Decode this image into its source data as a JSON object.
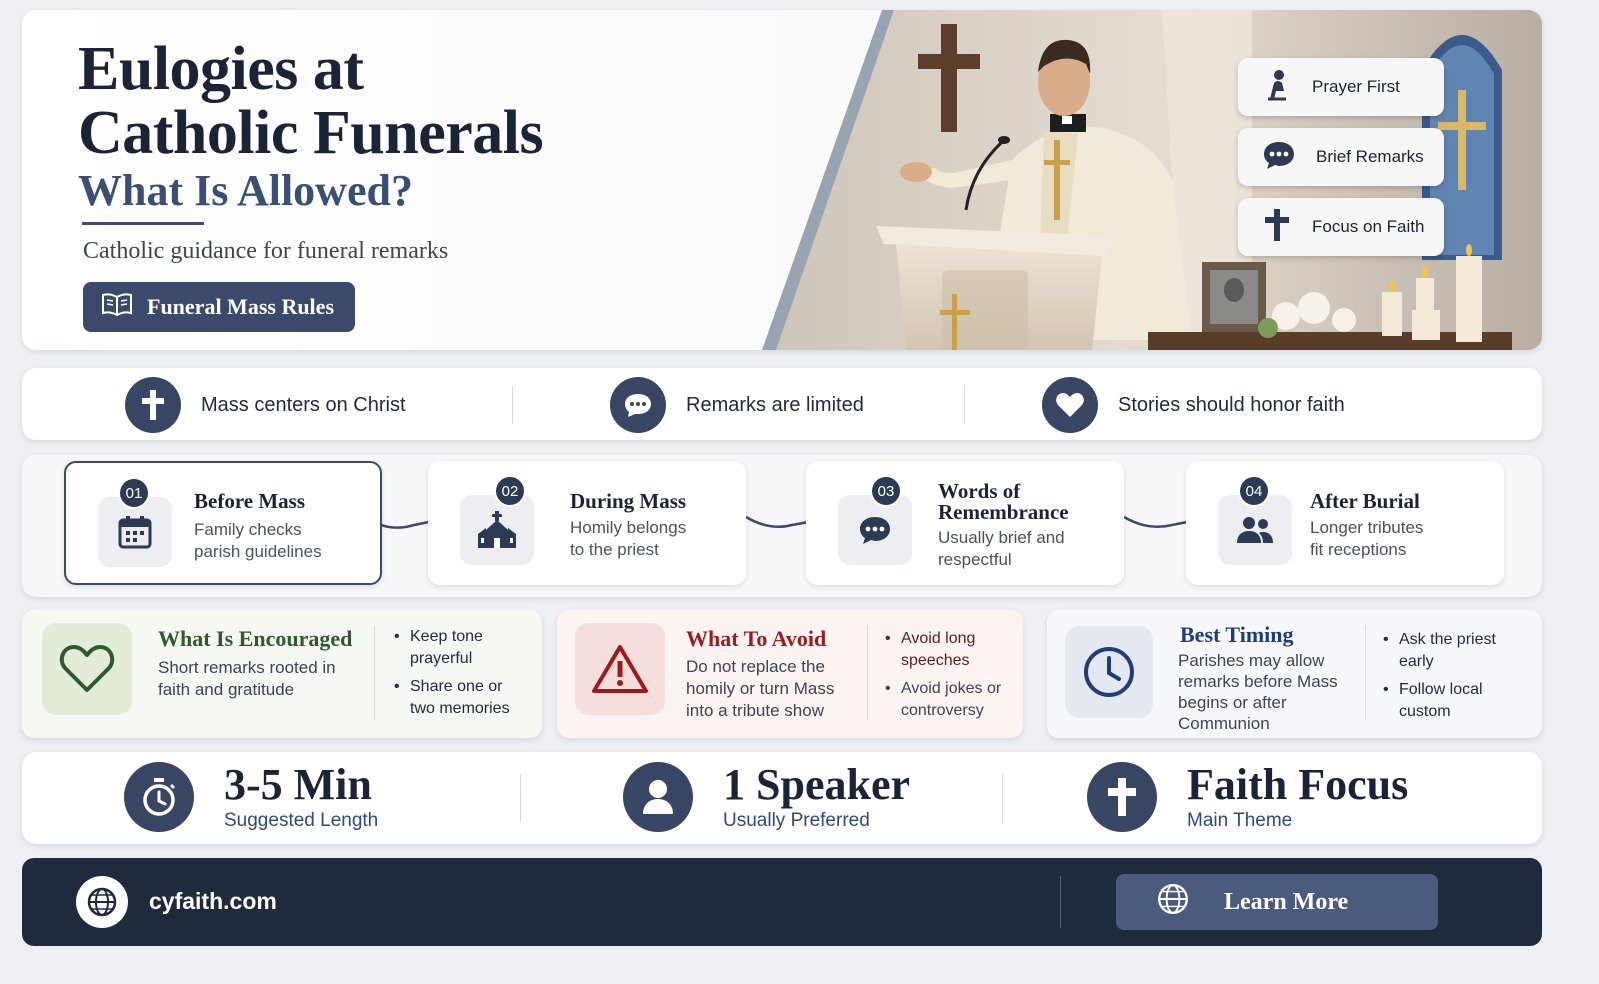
{
  "hero": {
    "title_line1": "Eulogies at",
    "title_line2": "Catholic Funerals",
    "title_line3": "What Is Allowed?",
    "subtitle": "Catholic guidance for funeral remarks",
    "button_label": "Funeral Mass Rules",
    "button_icon": "open-book-icon",
    "pills": [
      {
        "label": "Prayer First",
        "icon": "praying-person-icon"
      },
      {
        "label": "Brief Remarks",
        "icon": "speech-bubble-icon"
      },
      {
        "label": "Focus on Faith",
        "icon": "cross-icon"
      }
    ]
  },
  "principles": [
    {
      "label": "Mass centers on Christ",
      "icon": "cross-icon"
    },
    {
      "label": "Remarks are limited",
      "icon": "speech-bubble-icon"
    },
    {
      "label": "Stories should honor faith",
      "icon": "heart-icon"
    }
  ],
  "timeline": [
    {
      "number": "01",
      "title": "Before Mass",
      "desc_line1": "Family checks",
      "desc_line2": "parish guidelines",
      "icon": "calendar-icon"
    },
    {
      "number": "02",
      "title": "During Mass",
      "desc_line1": "Homily belongs",
      "desc_line2": "to the priest",
      "icon": "church-icon"
    },
    {
      "number": "03",
      "title_line1": "Words of",
      "title_line2": "Remembrance",
      "desc_line1": "Usually brief and",
      "desc_line2": "respectful",
      "icon": "speech-bubble-icon"
    },
    {
      "number": "04",
      "title": "After Burial",
      "desc_line1": "Longer tributes",
      "desc_line2": "fit receptions",
      "icon": "people-icon"
    }
  ],
  "guidance": {
    "encouraged": {
      "title": "What Is Encouraged",
      "text_line1": "Short remarks rooted in",
      "text_line2": "faith and gratitude",
      "bullets": [
        [
          "Keep tone",
          "prayerful"
        ],
        [
          "Share one or",
          "two memories"
        ]
      ],
      "icon": "heart-outline-icon",
      "accent": "#2f5a2f"
    },
    "avoid": {
      "title": "What To Avoid",
      "text_line1": "Do not replace the",
      "text_line2": "homily or turn Mass",
      "text_line3": "into a tribute show",
      "bullets": [
        [
          "Avoid long",
          "speeches"
        ],
        [
          "Avoid jokes or",
          "controversy"
        ]
      ],
      "icon": "warning-icon",
      "accent": "#9b1c1c"
    },
    "timing": {
      "title": "Best Timing",
      "text_line1": "Parishes may allow",
      "text_line2": "remarks before Mass",
      "text_line3": "begins or after",
      "text_line4": "Communion",
      "bullets": [
        [
          "Ask the priest",
          "early"
        ],
        [
          "Follow local",
          "custom"
        ]
      ],
      "icon": "clock-icon",
      "accent": "#1f3d7a"
    }
  },
  "stats": [
    {
      "value": "3-5 Min",
      "caption": "Suggested Length",
      "icon": "stopwatch-icon"
    },
    {
      "value": "1 Speaker",
      "caption": "Usually Preferred",
      "icon": "person-icon"
    },
    {
      "value": "Faith Focus",
      "caption": "Main Theme",
      "icon": "cross-icon"
    }
  ],
  "footer": {
    "site": "cyfaith.com",
    "button_label": "Learn More",
    "site_icon": "globe-icon",
    "button_icon": "globe-icon"
  },
  "colors": {
    "navy": "#1f2a3c",
    "slate": "#384663",
    "encouraged_bg": "#e3ecd9",
    "avoid_bg": "#f6dedd",
    "timing_bg": "#e4e8f0"
  }
}
